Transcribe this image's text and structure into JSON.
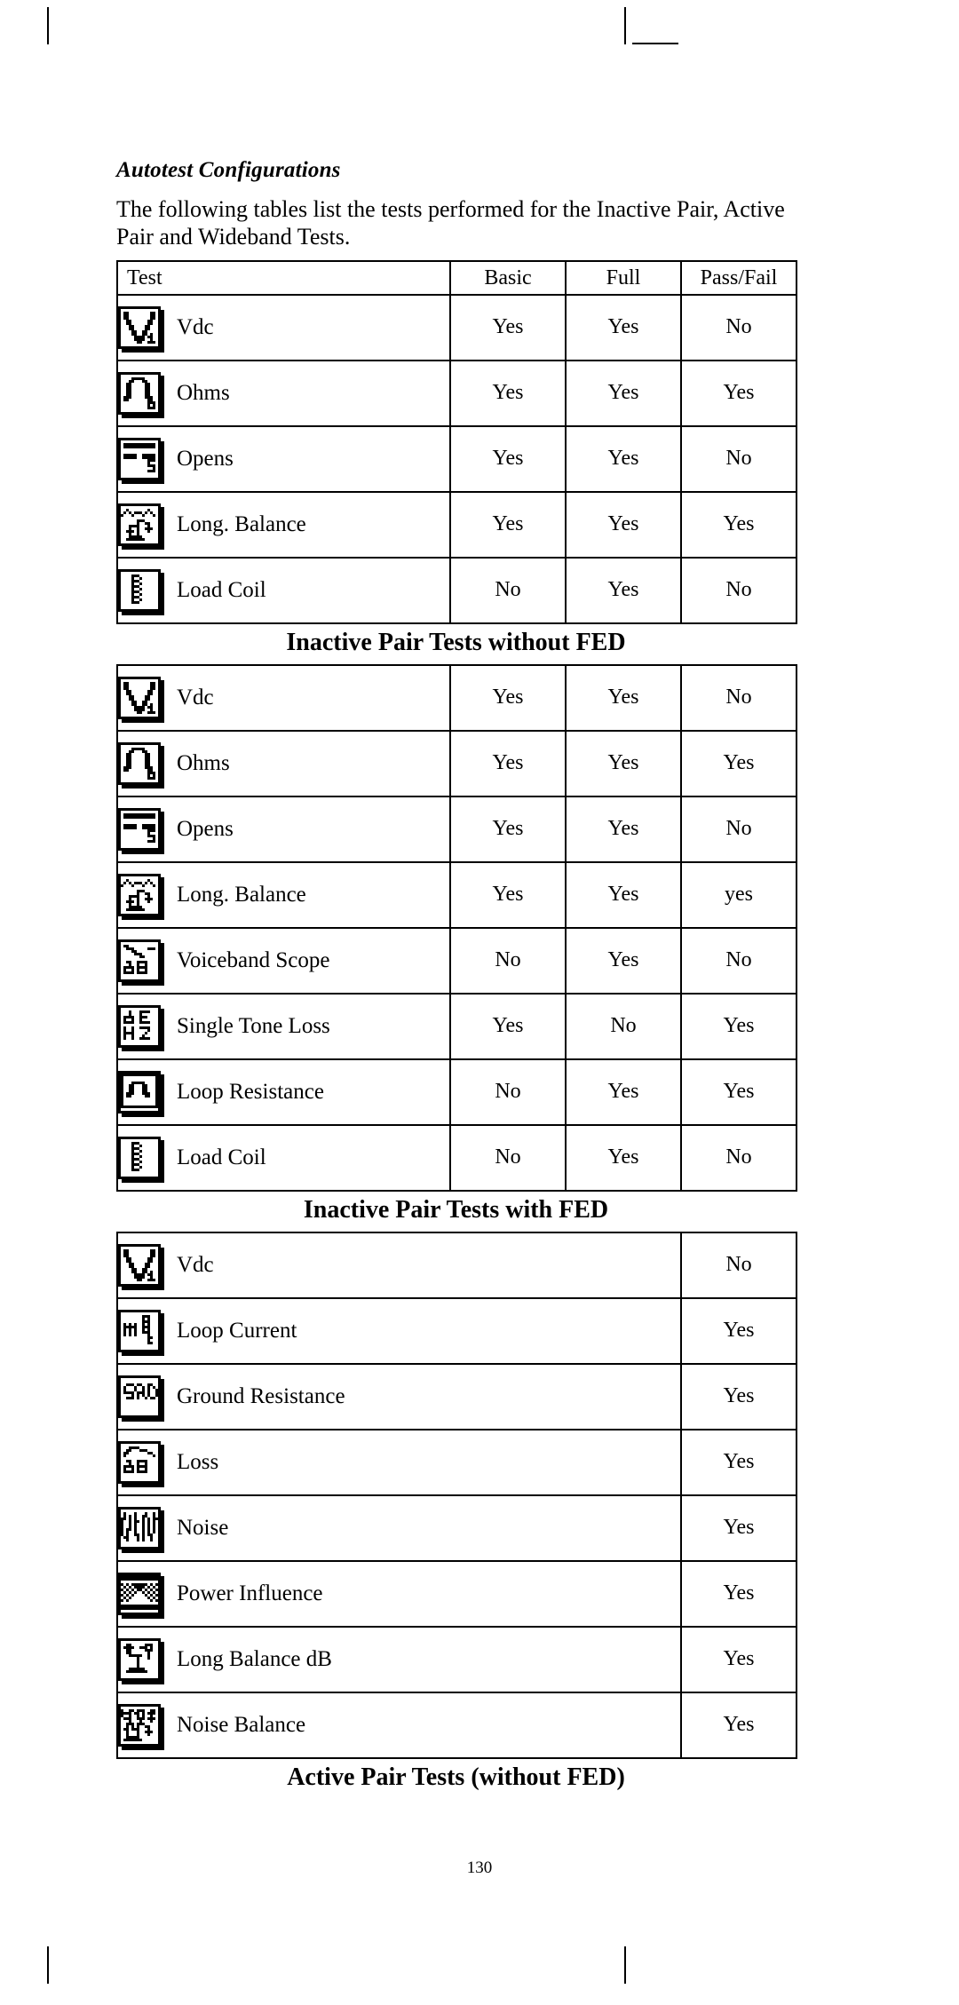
{
  "page": {
    "section_title": "Autotest Configurations",
    "intro": "The following tables list the tests performed for the Inactive Pair, Active Pair and Wideband Tests.",
    "page_number": "130"
  },
  "table1": {
    "caption": "Inactive Pair Tests without FED",
    "headers": {
      "test": "Test",
      "basic": "Basic",
      "full": "Full",
      "passfail": "Pass/Fail"
    },
    "rows": [
      {
        "icon": "vdc-icon",
        "label": "Vdc",
        "basic": "Yes",
        "full": "Yes",
        "passfail": "No"
      },
      {
        "icon": "ohms-icon",
        "label": "Ohms",
        "basic": "Yes",
        "full": "Yes",
        "passfail": "Yes"
      },
      {
        "icon": "opens-icon",
        "label": "Opens",
        "basic": "Yes",
        "full": "Yes",
        "passfail": "No"
      },
      {
        "icon": "long-balance-icon",
        "label": "Long. Balance",
        "basic": "Yes",
        "full": "Yes",
        "passfail": "Yes"
      },
      {
        "icon": "load-coil-icon",
        "label": "Load Coil",
        "basic": "No",
        "full": "Yes",
        "passfail": "No"
      }
    ]
  },
  "table2": {
    "caption": "Inactive Pair Tests with FED",
    "rows": [
      {
        "icon": "vdc-icon",
        "label": "Vdc",
        "basic": "Yes",
        "full": "Yes",
        "passfail": "No"
      },
      {
        "icon": "ohms-icon",
        "label": "Ohms",
        "basic": "Yes",
        "full": "Yes",
        "passfail": "Yes"
      },
      {
        "icon": "opens-icon",
        "label": "Opens",
        "basic": "Yes",
        "full": "Yes",
        "passfail": "No"
      },
      {
        "icon": "long-balance-icon",
        "label": "Long. Balance",
        "basic": "Yes",
        "full": "Yes",
        "passfail": "yes"
      },
      {
        "icon": "voiceband-scope-icon",
        "label": "Voiceband Scope",
        "basic": "No",
        "full": "Yes",
        "passfail": "No"
      },
      {
        "icon": "single-tone-loss-icon",
        "label": "Single Tone Loss",
        "basic": "Yes",
        "full": "No",
        "passfail": "Yes"
      },
      {
        "icon": "loop-resistance-icon",
        "label": "Loop Resistance",
        "basic": "No",
        "full": "Yes",
        "passfail": "Yes"
      },
      {
        "icon": "load-coil-icon",
        "label": "Load Coil",
        "basic": "No",
        "full": "Yes",
        "passfail": "No"
      }
    ]
  },
  "table3": {
    "caption": "Active Pair Tests (without FED)",
    "rows": [
      {
        "icon": "vdc-icon",
        "label": "Vdc",
        "passfail": "No"
      },
      {
        "icon": "loop-current-icon",
        "label": "Loop Current",
        "passfail": "Yes"
      },
      {
        "icon": "ground-resistance-icon",
        "label": "Ground Resistance",
        "passfail": "Yes"
      },
      {
        "icon": "loss-icon",
        "label": "Loss",
        "passfail": "Yes"
      },
      {
        "icon": "noise-icon",
        "label": "Noise",
        "passfail": "Yes"
      },
      {
        "icon": "power-influence-icon",
        "label": "Power Influence",
        "passfail": "Yes"
      },
      {
        "icon": "long-balance-db-icon",
        "label": "Long Balance dB",
        "passfail": "Yes"
      },
      {
        "icon": "noise-balance-icon",
        "label": "Noise Balance",
        "passfail": "Yes"
      }
    ]
  }
}
